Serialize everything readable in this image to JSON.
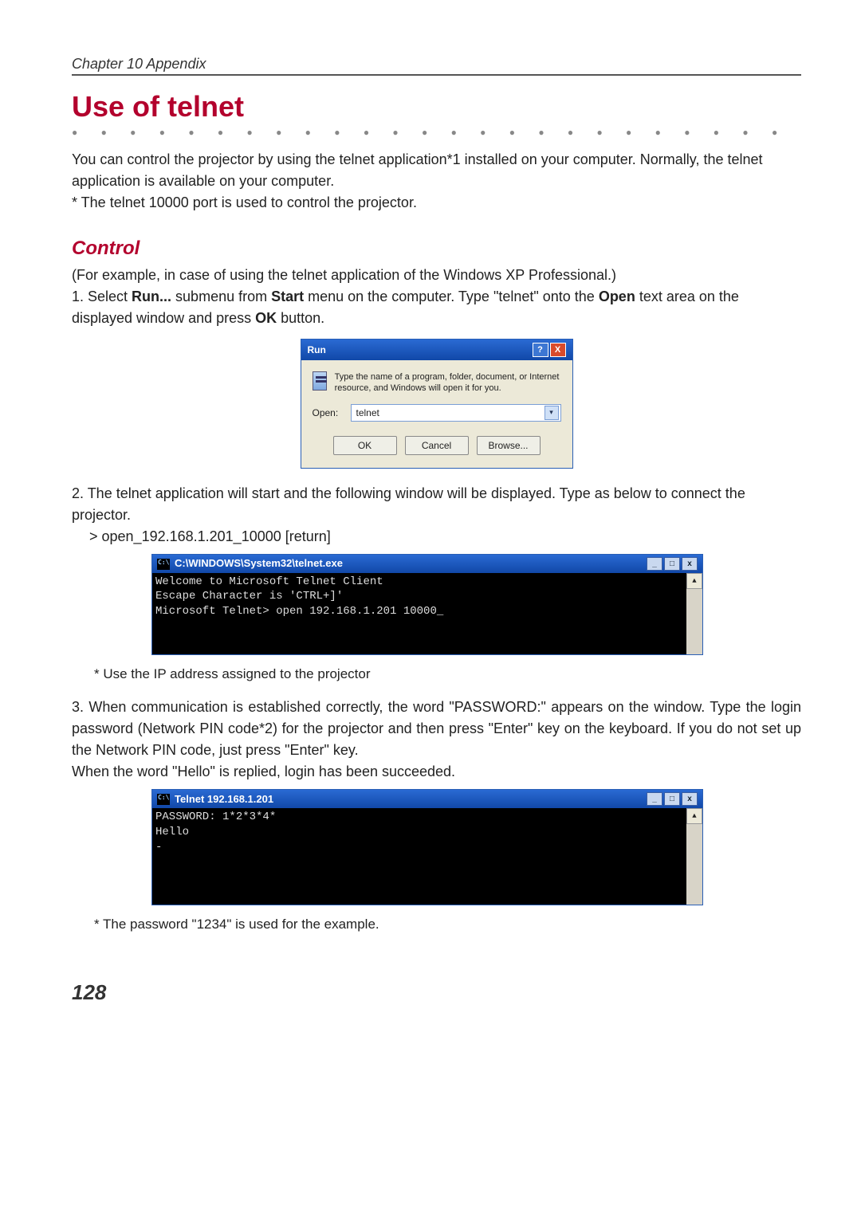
{
  "chapter": "Chapter 10 Appendix",
  "title": "Use of telnet",
  "intro": "You can control the projector by using the telnet application*1 installed on your computer.  Normally, the telnet application is available on your computer.",
  "intro_note": "* The telnet 10000 port is used to control the projector.",
  "section": "Control",
  "control_preface": "(For example, in case of using the telnet application of the Windows XP Professional.)",
  "step1_a": "1. Select ",
  "step1_run": "Run...",
  "step1_b": " submenu from ",
  "step1_start": "Start",
  "step1_c": " menu on the computer. Type \"telnet\" onto the ",
  "step1_open": "Open",
  "step1_d": " text area on the displayed window and press ",
  "step1_ok": "OK",
  "step1_e": " button.",
  "run": {
    "title": "Run",
    "help": "?",
    "close": "X",
    "desc": "Type the name of a program, folder, document, or Internet resource, and Windows will open it for you.",
    "open_label": "Open:",
    "value": "telnet",
    "ok": "OK",
    "cancel": "Cancel",
    "browse": "Browse..."
  },
  "step2": "2. The telnet application will start and the following window will be displayed. Type as below to connect the projector.",
  "step2_cmd": "   > open_192.168.1.201_10000 [return]",
  "telnet1": {
    "title": "C:\\WINDOWS\\System32\\telnet.exe",
    "min": "_",
    "max": "□",
    "close": "x",
    "content": "Welcome to Microsoft Telnet Client\nEscape Character is 'CTRL+]'\nMicrosoft Telnet> open 192.168.1.201 10000_\n\n\n"
  },
  "note1": "* Use the IP address assigned to the projector",
  "step3": "3. When communication is established correctly, the word \"PASSWORD:\" appears on the window. Type the login password (Network PIN code*2) for the projector and then press \"Enter\" key on the keyboard. If you do not set up the Network PIN code, just press \"Enter\" key.\n When the word \"Hello\" is replied, login has been succeeded.",
  "telnet2": {
    "title": "Telnet 192.168.1.201",
    "content": "PASSWORD: 1*2*3*4*\nHello\n-\n\n\n\n"
  },
  "note2": "* The password \"1234\" is used for the example.",
  "page_number": "128",
  "scroll_up": "▲"
}
